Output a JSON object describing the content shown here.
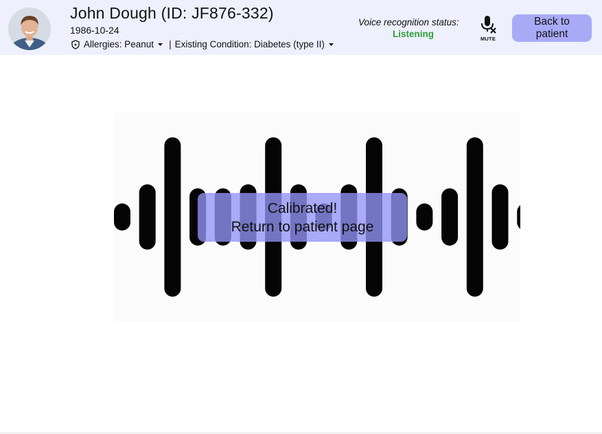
{
  "header": {
    "patient_name": "John Dough (ID: JF876-332)",
    "patient_dob": "1986-10-24",
    "allergies_label": "Allergies: Peanut",
    "separator": "|",
    "condition_label": "Existing Condition: Diabetes (type II)"
  },
  "voice": {
    "label": "Voice recognition status:",
    "status": "Listening",
    "status_color": "#2f9e3a",
    "mute_label": "MUTE"
  },
  "back_button": {
    "line1": "Back to",
    "line2": "patient"
  },
  "calibration": {
    "line1": "Calibrated!",
    "line2": "Return to patient page"
  },
  "waveform": {
    "bar_levels": [
      0.17,
      0.41,
      1.0,
      0.36,
      0.36,
      0.41,
      1.0,
      0.41,
      0.17,
      0.41,
      1.0,
      0.36,
      0.17,
      0.36,
      1.0,
      0.41,
      0.17
    ],
    "bar_color": "#050505"
  },
  "colors": {
    "header_bg": "#eef0fd",
    "button_bg": "#a9aaf6",
    "overlay_bg": "#9294f7"
  },
  "icons": {
    "avatar": "avatar-photo",
    "allergy": "shield-icon",
    "dropdown": "caret-down-icon",
    "mute": "microphone-muted-icon"
  }
}
